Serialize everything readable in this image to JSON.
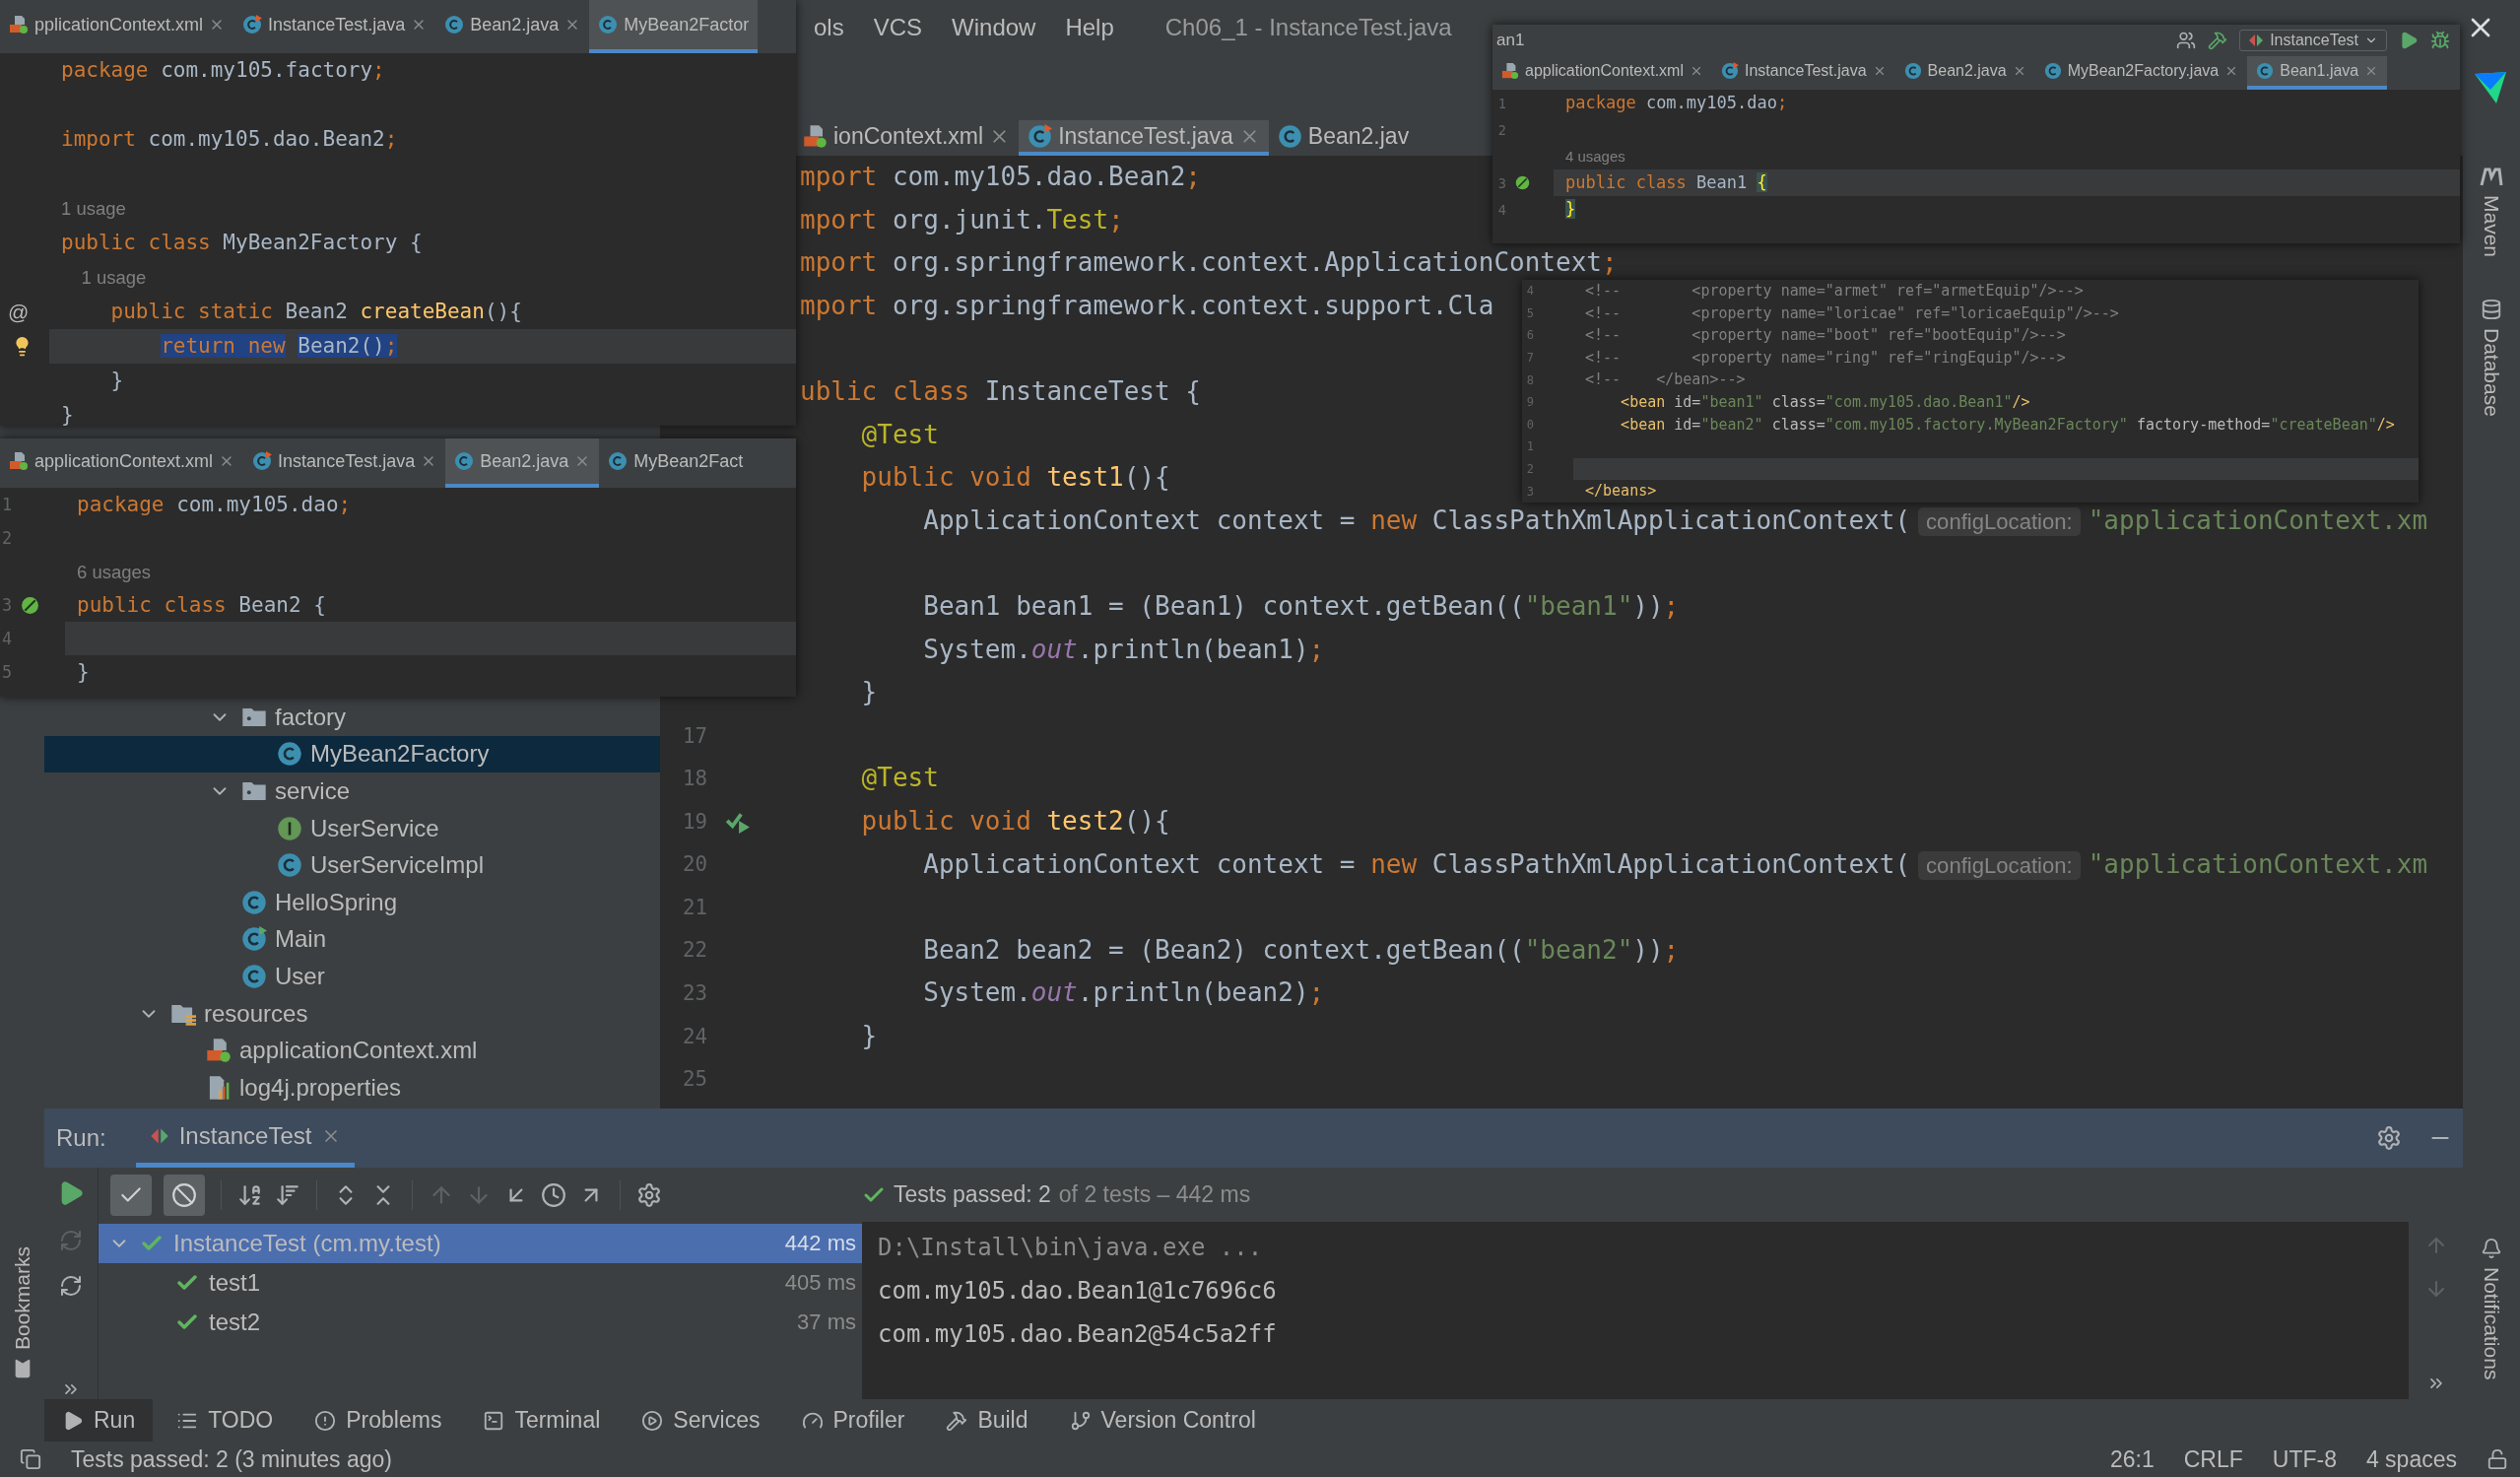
{
  "menu": {
    "items": [
      "ols",
      "VCS",
      "Window",
      "Help"
    ],
    "title": "Ch06_1 - InstanceTest.java"
  },
  "editor": {
    "tabs": [
      {
        "label": "ionContext.xml",
        "kind": "xml",
        "selected": false,
        "close": true
      },
      {
        "label": "InstanceTest.java",
        "kind": "test",
        "selected": true,
        "close": true
      },
      {
        "label": "Bean2.jav",
        "kind": "class",
        "selected": false,
        "close": false
      }
    ],
    "blocks": [
      [
        {
          "code": [
            {
              "kind": "keyword",
              "text": "mport"
            },
            {
              "kind": "plain",
              "text": " com.my105.dao.Bean2"
            },
            {
              "kind": "keyword",
              "text": ";"
            }
          ]
        },
        {
          "code": [
            {
              "kind": "keyword",
              "text": "mport"
            },
            {
              "kind": "plain",
              "text": " org.junit."
            },
            {
              "kind": "annotation",
              "text": "Test"
            },
            {
              "kind": "keyword",
              "text": ";"
            }
          ]
        },
        {
          "code": [
            {
              "kind": "keyword",
              "text": "mport"
            },
            {
              "kind": "plain",
              "text": " org.springframework.context.ApplicationContext"
            },
            {
              "kind": "keyword",
              "text": ";"
            }
          ]
        },
        {
          "code": [
            {
              "kind": "keyword",
              "text": "mport"
            },
            {
              "kind": "plain",
              "text": " org.springframework.context.support.Cla"
            }
          ]
        }
      ],
      [
        {
          "code": [
            {
              "kind": "keyword",
              "text": "ublic class"
            },
            {
              "kind": "plain",
              "text": " InstanceTest {"
            }
          ]
        },
        {
          "code": [
            {
              "kind": "annotation",
              "text": "    @Test"
            }
          ]
        },
        {
          "code": [
            {
              "kind": "keyword",
              "text": "    public void "
            },
            {
              "kind": "method",
              "text": "test1"
            },
            {
              "kind": "plain",
              "text": "(){"
            }
          ]
        },
        {
          "code": [
            {
              "kind": "plain",
              "text": "        ApplicationContext context = "
            },
            {
              "kind": "keyword",
              "text": "new"
            },
            {
              "kind": "plain",
              "text": " ClassPathXmlApplicationContext("
            },
            {
              "kind": "hint",
              "text": "configLocation:"
            },
            {
              "kind": "string",
              "text": "\"applicationContext.xm"
            }
          ]
        }
      ],
      [
        {
          "code": [
            {
              "kind": "plain",
              "text": "        Bean1 bean1 = (Bean1) context.getBean(("
            },
            {
              "kind": "string",
              "text": "\"bean1\""
            },
            {
              "kind": "plain",
              "text": "))"
            },
            {
              "kind": "keyword",
              "text": ";"
            }
          ]
        },
        {
          "code": [
            {
              "kind": "plain",
              "text": "        System."
            },
            {
              "kind": "field",
              "text": "out"
            },
            {
              "kind": "plain",
              "text": ".println(bean1)"
            },
            {
              "kind": "keyword",
              "text": ";"
            }
          ]
        },
        {
          "code": [
            {
              "kind": "plain",
              "text": "    }"
            }
          ]
        },
        {
          "number": "17"
        },
        {
          "number": "18",
          "code": [
            {
              "kind": "annotation",
              "text": "    @Test"
            }
          ]
        },
        {
          "number": "19",
          "marker": {
            "kind": "run"
          },
          "code": [
            {
              "kind": "keyword",
              "text": "    public void "
            },
            {
              "kind": "method",
              "text": "test2"
            },
            {
              "kind": "plain",
              "text": "(){"
            }
          ]
        },
        {
          "number": "20",
          "code": [
            {
              "kind": "plain",
              "text": "        ApplicationContext context = "
            },
            {
              "kind": "keyword",
              "text": "new"
            },
            {
              "kind": "plain",
              "text": " ClassPathXmlApplicationContext("
            },
            {
              "kind": "hint",
              "text": "configLocation:"
            },
            {
              "kind": "string",
              "text": "\"applicationContext.xm"
            }
          ]
        },
        {
          "number": "21"
        },
        {
          "number": "22",
          "code": [
            {
              "kind": "plain",
              "text": "        Bean2 bean2 = (Bean2) context.getBean(("
            },
            {
              "kind": "string",
              "text": "\"bean2\""
            },
            {
              "kind": "plain",
              "text": "))"
            },
            {
              "kind": "keyword",
              "text": ";"
            }
          ]
        },
        {
          "number": "23",
          "code": [
            {
              "kind": "plain",
              "text": "        System."
            },
            {
              "kind": "field",
              "text": "out"
            },
            {
              "kind": "plain",
              "text": ".println(bean2)"
            },
            {
              "kind": "keyword",
              "text": ";"
            }
          ]
        },
        {
          "number": "24",
          "code": [
            {
              "kind": "plain",
              "text": "    }"
            }
          ]
        },
        {
          "number": "25"
        }
      ]
    ]
  },
  "project_tree": [
    {
      "children": [
        {
          "children": [
            {
              "label": "factory",
              "kind": "folder",
              "expanded": true,
              "selected": false,
              "children": [
                {
                  "label": "MyBean2Factory",
                  "kind": "class",
                  "selected": true
                }
              ]
            },
            {
              "label": "service",
              "kind": "folder",
              "expanded": true,
              "selected": false,
              "children": [
                {
                  "label": "UserService",
                  "kind": "interface",
                  "selected": false
                },
                {
                  "label": "UserServiceImpl",
                  "kind": "class",
                  "selected": false
                }
              ]
            },
            {
              "label": "HelloSpring",
              "kind": "class",
              "selected": false
            },
            {
              "label": "Main",
              "kind": "main",
              "selected": false
            },
            {
              "label": "User",
              "kind": "class",
              "selected": false
            }
          ]
        }
      ]
    },
    {
      "label": "resources",
      "kind": "resources",
      "expanded": true,
      "selected": false,
      "children": [
        {
          "label": "applicationContext.xml",
          "kind": "xml",
          "selected": false
        },
        {
          "label": "log4j.properties",
          "kind": "properties",
          "selected": false
        }
      ]
    }
  ],
  "windows": [
    {
      "tabs": [
        {
          "label": "pplicationContext.xml",
          "kind": "xml",
          "selected": false,
          "close": true
        },
        {
          "label": "InstanceTest.java",
          "kind": "test",
          "selected": false,
          "close": true
        },
        {
          "label": "Bean2.java",
          "kind": "class",
          "selected": false,
          "close": true
        },
        {
          "label": "MyBean2Factor",
          "kind": "class",
          "selected": true,
          "close": false
        }
      ],
      "blocks": [
        [
          {
            "current": false,
            "code": [
              {
                "kind": "keyword",
                "text": "package"
              },
              {
                "kind": "plain",
                "text": " com.my105.factory"
              },
              {
                "kind": "keyword",
                "text": ";"
              }
            ]
          }
        ],
        [
          {
            "current": false,
            "code": [
              {
                "kind": "keyword",
                "text": "import"
              },
              {
                "kind": "plain",
                "text": " com.my105.dao.Bean2"
              },
              {
                "kind": "keyword",
                "text": ";"
              }
            ]
          }
        ],
        [
          {
            "current": false,
            "code": [
              {
                "kind": "usage",
                "text": "1 usage"
              }
            ]
          },
          {
            "current": false,
            "code": [
              {
                "kind": "keyword",
                "text": "public class"
              },
              {
                "kind": "plain",
                "text": " MyBean2Factory {"
              }
            ]
          },
          {
            "current": false,
            "code": [
              {
                "kind": "usage",
                "text": "    1 usage"
              }
            ]
          },
          {
            "current": false,
            "gutter": "@",
            "code": [
              {
                "kind": "keyword",
                "text": "    public static"
              },
              {
                "kind": "plain",
                "text": " Bean2 "
              },
              {
                "kind": "method",
                "text": "createBean"
              },
              {
                "kind": "plain",
                "text": "(){"
              }
            ]
          },
          {
            "current": true,
            "marker": {
              "kind": "bulb"
            },
            "code": [
              {
                "kind": "selected-keyword",
                "text": "        return new"
              },
              {
                "kind": "selected-plain",
                "text": " Bean2()"
              },
              {
                "kind": "selected-keyword",
                "text": ";"
              }
            ]
          },
          {
            "current": false,
            "code": [
              {
                "kind": "plain",
                "text": "    }"
              }
            ]
          },
          {
            "current": false,
            "code": [
              {
                "kind": "plain",
                "text": "}"
              }
            ]
          }
        ]
      ]
    },
    {
      "tabs": [
        {
          "label": "applicationContext.xml",
          "kind": "xml",
          "selected": false,
          "close": true
        },
        {
          "label": "InstanceTest.java",
          "kind": "test",
          "selected": false,
          "close": true
        },
        {
          "label": "Bean2.java",
          "kind": "class",
          "selected": true,
          "close": true
        },
        {
          "label": "MyBean2Fact",
          "kind": "class",
          "selected": false,
          "close": false
        }
      ],
      "blocks": [
        [
          {
            "number": "1",
            "current": false,
            "code": [
              {
                "kind": "keyword",
                "text": "package"
              },
              {
                "kind": "plain",
                "text": " com.my105.dao"
              },
              {
                "kind": "keyword",
                "text": ";"
              }
            ]
          },
          {
            "number": "2",
            "current": false
          },
          {
            "current": false,
            "code": [
              {
                "kind": "usage",
                "text": "6 usages"
              }
            ]
          },
          {
            "number": "3",
            "current": false,
            "marker": {
              "kind": "bean"
            },
            "code": [
              {
                "kind": "keyword",
                "text": "public class"
              },
              {
                "kind": "plain",
                "text": " Bean2 {"
              }
            ]
          },
          {
            "number": "4",
            "current": true
          },
          {
            "number": "5",
            "current": false,
            "code": [
              {
                "kind": "plain",
                "text": "}"
              }
            ]
          }
        ]
      ]
    },
    {
      "title": "an1",
      "run_config": "InstanceTest",
      "tabs": [
        {
          "label": "applicationContext.xml",
          "kind": "xml",
          "selected": false,
          "close": true
        },
        {
          "label": "InstanceTest.java",
          "kind": "test",
          "selected": false,
          "close": true
        },
        {
          "label": "Bean2.java",
          "kind": "class",
          "selected": false,
          "close": true
        },
        {
          "label": "MyBean2Factory.java",
          "kind": "class",
          "selected": false,
          "close": true
        },
        {
          "label": "Bean1.java",
          "kind": "class",
          "selected": true,
          "close": true
        }
      ],
      "blocks": [
        [
          {
            "number": "1",
            "current": false,
            "code": [
              {
                "kind": "keyword",
                "text": "package"
              },
              {
                "kind": "plain",
                "text": " com.my105.dao"
              },
              {
                "kind": "keyword",
                "text": ";"
              }
            ]
          },
          {
            "number": "2",
            "current": false
          },
          {
            "current": false,
            "code": [
              {
                "kind": "usage",
                "text": "4 usages"
              }
            ]
          },
          {
            "number": "3",
            "current": true,
            "marker": {
              "kind": "bean"
            },
            "code": [
              {
                "kind": "keyword",
                "text": "public class"
              },
              {
                "kind": "plain",
                "text": " Bean1 "
              },
              {
                "kind": "brace",
                "text": "{"
              }
            ]
          },
          {
            "number": "4",
            "current": false,
            "code": [
              {
                "kind": "brace-match",
                "text": "}"
              }
            ]
          }
        ]
      ]
    },
    {
      "blocks": [
        [
          {
            "number": "4",
            "current": false,
            "code": [
              {
                "kind": "comment",
                "text": "<!--        <property name=\"armet\" ref=\"armetEquip\"/>-->"
              }
            ]
          },
          {
            "number": "5",
            "current": false,
            "code": [
              {
                "kind": "comment",
                "text": "<!--        <property name=\"loricae\" ref=\"loricaeEquip\"/>-->"
              }
            ]
          },
          {
            "number": "6",
            "current": false,
            "code": [
              {
                "kind": "comment",
                "text": "<!--        <property name=\"boot\" ref=\"bootEquip\"/>-->"
              }
            ]
          },
          {
            "number": "7",
            "current": false,
            "code": [
              {
                "kind": "comment",
                "text": "<!--        <property name=\"ring\" ref=\"ringEquip\"/>-->"
              }
            ]
          },
          {
            "number": "8",
            "current": false,
            "code": [
              {
                "kind": "comment",
                "text": "<!--    </bean>-->"
              }
            ]
          },
          {
            "number": "9",
            "current": false,
            "code": [
              {
                "kind": "tag",
                "text": "    <bean"
              },
              {
                "kind": "attr",
                "text": " id="
              },
              {
                "kind": "string",
                "text": "\"bean1\""
              },
              {
                "kind": "attr",
                "text": " class="
              },
              {
                "kind": "string",
                "text": "\"com.my105.dao.Bean1\""
              },
              {
                "kind": "tag",
                "text": "/>"
              }
            ]
          },
          {
            "number": "0",
            "current": false,
            "code": [
              {
                "kind": "tag",
                "text": "    <bean"
              },
              {
                "kind": "attr",
                "text": " id="
              },
              {
                "kind": "string",
                "text": "\"bean2\""
              },
              {
                "kind": "attr",
                "text": " class="
              },
              {
                "kind": "string",
                "text": "\"com.my105.factory.MyBean2Factory\""
              },
              {
                "kind": "attr",
                "text": " factory-method="
              },
              {
                "kind": "string",
                "text": "\"createBean\""
              },
              {
                "kind": "tag",
                "text": "/>"
              }
            ]
          },
          {
            "number": "1",
            "current": false
          },
          {
            "number": "2",
            "current": true
          },
          {
            "number": "3",
            "current": false,
            "code": [
              {
                "kind": "tag",
                "text": "</beans>"
              }
            ]
          }
        ]
      ]
    }
  ],
  "run": {
    "label": "Run:",
    "tab": {
      "label": "InstanceTest",
      "selected": true
    },
    "filters": [
      {
        "kind": "passed",
        "on": true
      },
      {
        "kind": "ignored",
        "on": true
      }
    ],
    "status": {
      "text": "Tests passed: 2",
      "detail": "of 2 tests – 442 ms"
    },
    "tests": [
      {
        "label": "InstanceTest (cm.my.test)",
        "time": "442 ms",
        "selected": true,
        "expanded": true,
        "children": [
          {
            "label": "test1",
            "time": "405 ms",
            "selected": false
          },
          {
            "label": "test2",
            "time": "37 ms",
            "selected": false
          }
        ]
      }
    ],
    "console": [
      "D:\\Install\\bin\\java.exe ...",
      "com.my105.dao.Bean1@1c7696c6",
      "com.my105.dao.Bean2@54c5a2ff"
    ]
  },
  "side": {
    "left": [
      "Bookmarks"
    ],
    "right_top": [
      "Maven",
      "Database"
    ],
    "right_bottom": [
      "Notifications"
    ]
  },
  "tool_tabs": [
    {
      "label": "Run",
      "kind": "run",
      "selected": true
    },
    {
      "label": "TODO",
      "kind": "todo",
      "selected": false
    },
    {
      "label": "Problems",
      "kind": "problems",
      "selected": false
    },
    {
      "label": "Terminal",
      "kind": "terminal",
      "selected": false
    },
    {
      "label": "Services",
      "kind": "services",
      "selected": false
    },
    {
      "label": "Profiler",
      "kind": "profiler",
      "selected": false
    },
    {
      "label": "Build",
      "kind": "build",
      "selected": false
    },
    {
      "label": "Version Control",
      "kind": "vcs",
      "selected": false
    }
  ],
  "status_bar": {
    "message": "Tests passed: 2 (3 minutes ago)",
    "items": [
      "26:1",
      "CRLF",
      "UTF-8",
      "4 spaces"
    ]
  }
}
